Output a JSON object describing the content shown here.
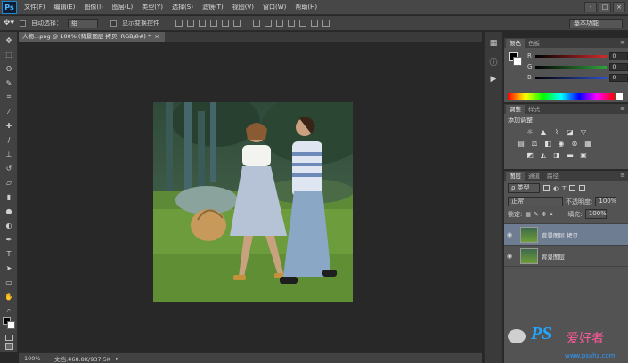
{
  "menubar": {
    "logo": "Ps",
    "items": [
      "文件(F)",
      "编辑(E)",
      "图像(I)",
      "图层(L)",
      "类型(Y)",
      "选择(S)",
      "滤镜(T)",
      "视图(V)",
      "窗口(W)",
      "帮助(H)"
    ],
    "window_controls": [
      "-",
      "□",
      "×"
    ]
  },
  "options_bar": {
    "auto_select_label": "自动选择：",
    "auto_select_value": "组",
    "show_transform_label": "显示变换控件",
    "workspace": "基本功能"
  },
  "document": {
    "tab_title": "人物...png @ 100% (背景图层 拷贝, RGB/8#) *",
    "close": "×"
  },
  "status": {
    "zoom": "100%",
    "doc_size": "文档:468.8K/937.5K"
  },
  "color_panel": {
    "tabs": [
      "颜色",
      "色板"
    ],
    "channels": [
      {
        "label": "R",
        "value": "0",
        "color": "#d22b2b"
      },
      {
        "label": "G",
        "value": "0",
        "color": "#2fa33a"
      },
      {
        "label": "B",
        "value": "0",
        "color": "#2e4fd0"
      }
    ]
  },
  "adjust_panel": {
    "tabs": [
      "调整",
      "样式"
    ],
    "title": "添加调整",
    "icons_row1": [
      "brightness-icon",
      "levels-icon",
      "curves-icon",
      "exposure-icon",
      "vibrance-icon"
    ],
    "icons_row2": [
      "hue-icon",
      "colorbalance-icon",
      "bw-icon",
      "photofilter-icon",
      "mixer-icon",
      "lookup-icon"
    ],
    "icons_row3": [
      "invert-icon",
      "posterize-icon",
      "threshold-icon",
      "gradientmap-icon",
      "selectivecolor-icon"
    ]
  },
  "layers_panel": {
    "tabs": [
      "图层",
      "通道",
      "路径"
    ],
    "filter_value": "ρ 类型",
    "blend_mode": "正常",
    "opacity_label": "不透明度:",
    "opacity_value": "100%",
    "lock_label": "锁定:",
    "fill_label": "填充:",
    "fill_value": "100%",
    "layers": [
      {
        "name": "背景图层 拷贝",
        "selected": true
      },
      {
        "name": "背景图层",
        "selected": false
      }
    ]
  },
  "watermark": {
    "brand": "PS",
    "text": "爱好者",
    "url": "www.psahz.com"
  }
}
